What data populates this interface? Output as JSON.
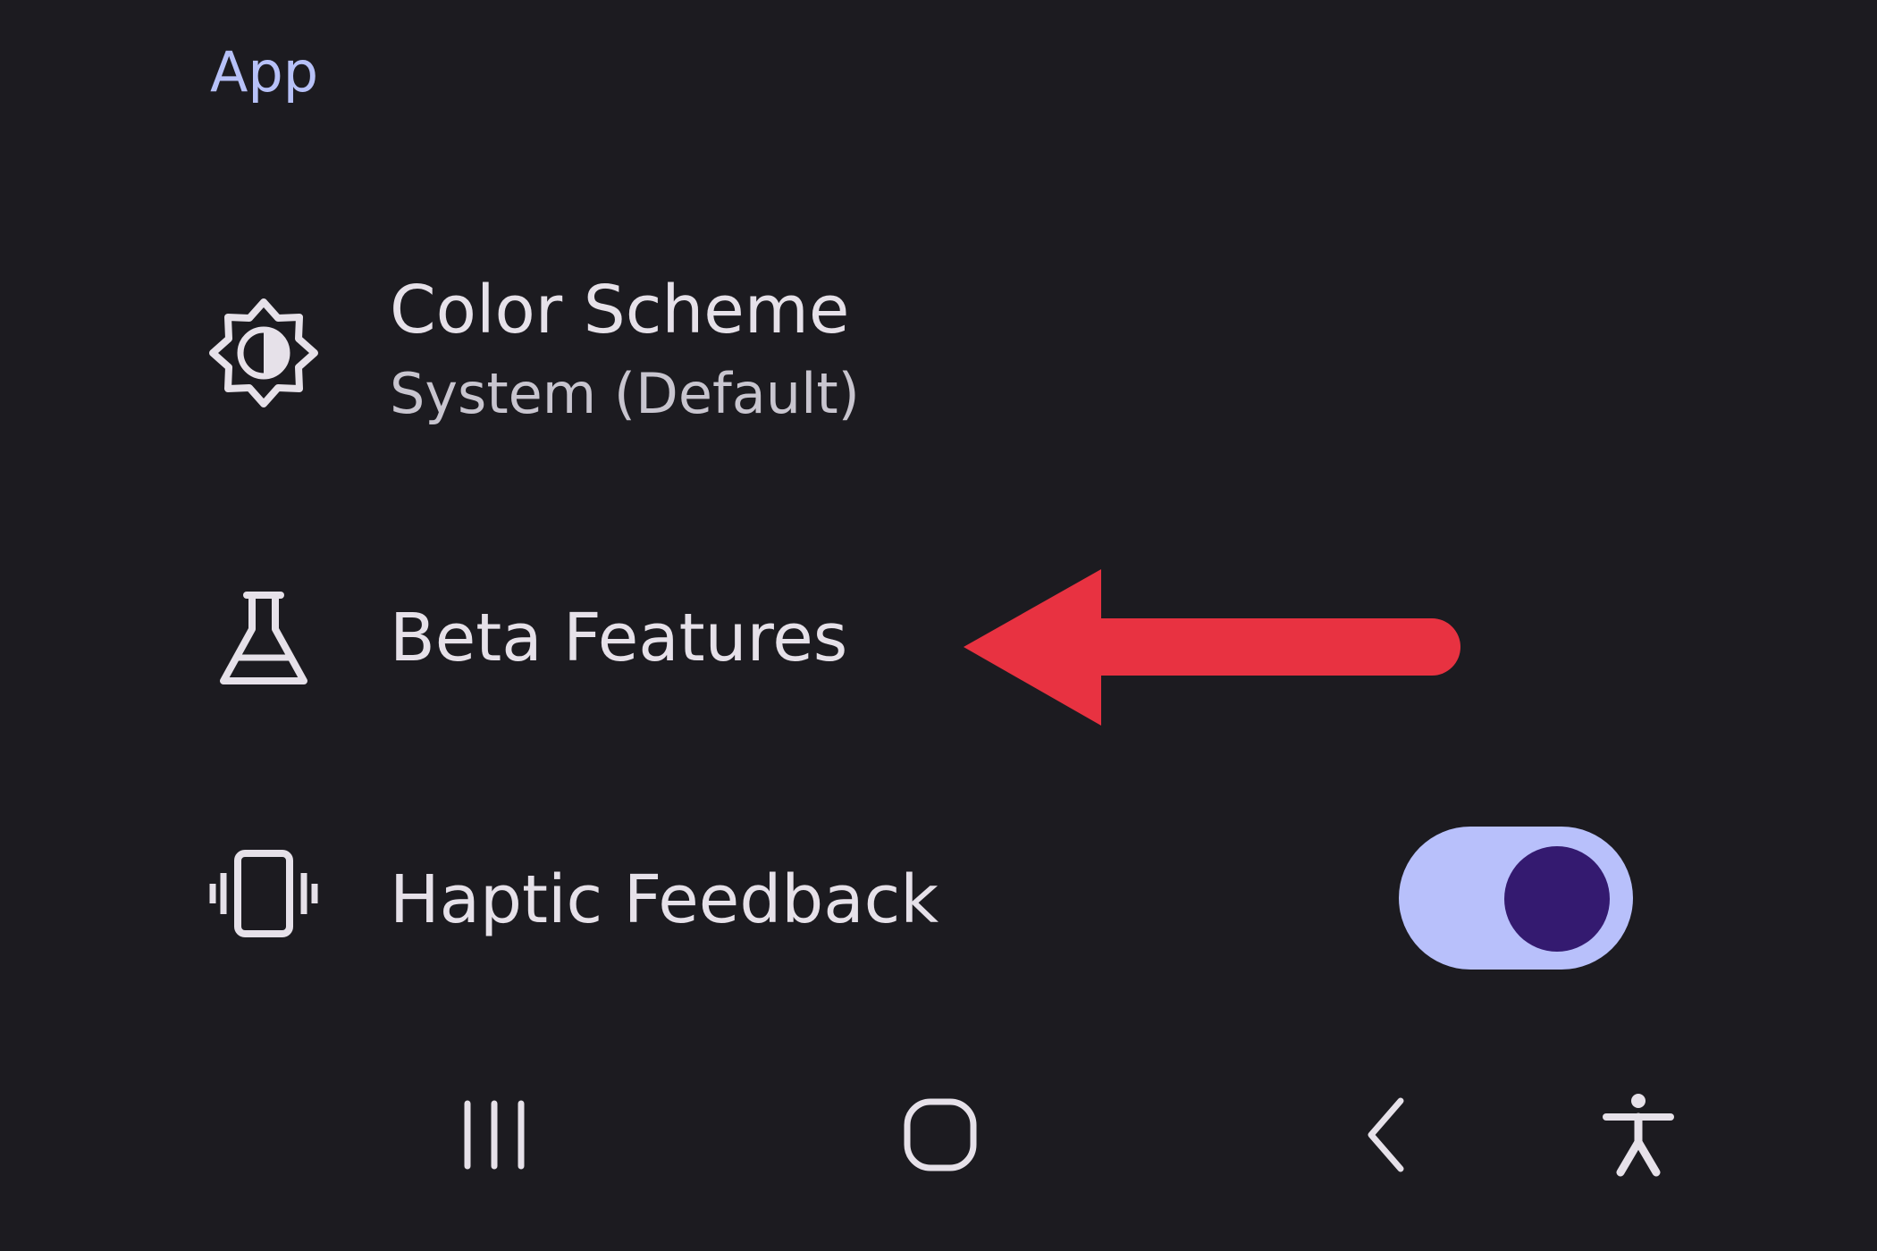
{
  "section": {
    "title": "App"
  },
  "settings": [
    {
      "id": "color-scheme",
      "icon": "brightness-contrast-icon",
      "title": "Color Scheme",
      "subtitle": "System (Default)"
    },
    {
      "id": "beta-features",
      "icon": "flask-icon",
      "title": "Beta Features"
    },
    {
      "id": "haptic-feedback",
      "icon": "vibration-icon",
      "title": "Haptic Feedback",
      "toggle_on": true
    }
  ],
  "navigation_bar": {
    "buttons": [
      "recent-apps-icon",
      "home-icon",
      "back-icon",
      "accessibility-icon"
    ]
  },
  "annotation": {
    "type": "arrow",
    "color": "#e83241",
    "points_to": "Beta Features"
  },
  "colors": {
    "background": "#1c1b20",
    "accent": "#b7c1f8",
    "toggle_track": "#b8c0fb",
    "toggle_knob": "#341a70",
    "text_primary": "#e6e1e9",
    "text_secondary": "#c8c5cf"
  }
}
